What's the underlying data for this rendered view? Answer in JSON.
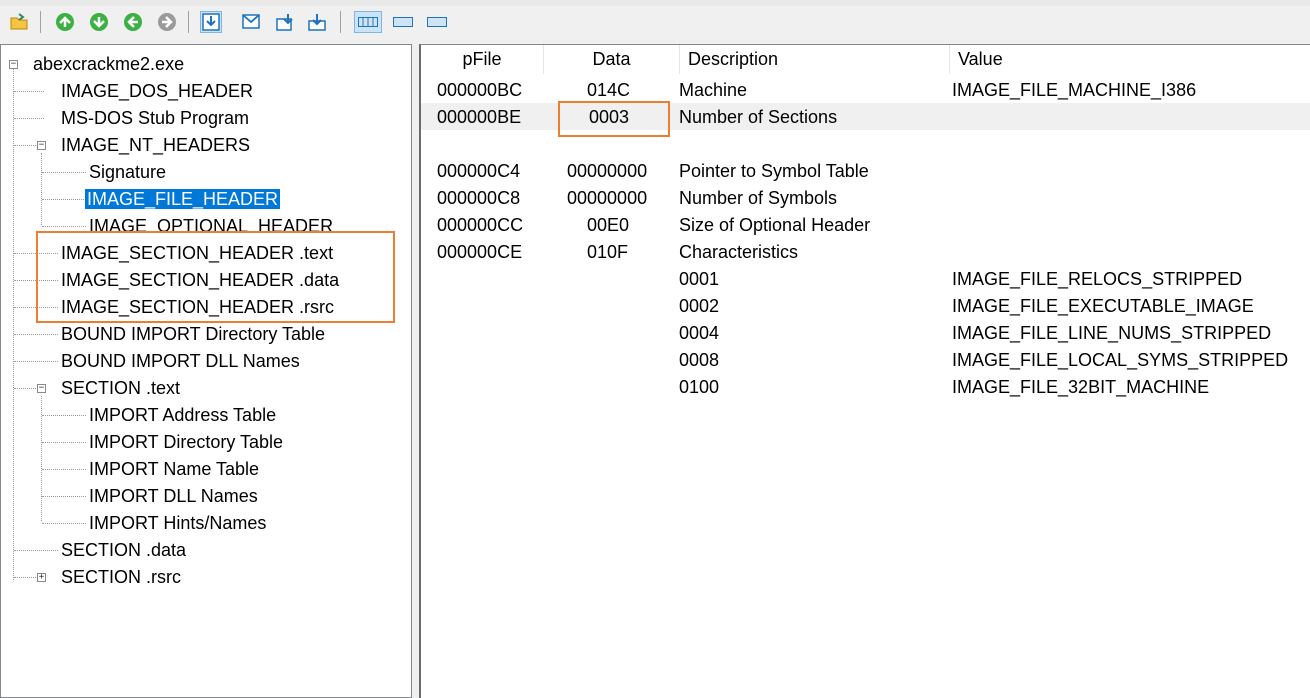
{
  "toolbar": {
    "buttons": [
      "open-icon",
      "up-green-icon",
      "down-green-icon",
      "back-green-icon",
      "forward-gray-icon",
      "view-details-icon",
      "view-mail-icon",
      "view-insert-icon",
      "view-download-icon",
      "view-bytes-icon",
      "view-small-icon",
      "view-wide-icon"
    ]
  },
  "tree": {
    "root": "abexcrackme2.exe",
    "items": [
      "IMAGE_DOS_HEADER",
      "MS-DOS Stub Program",
      "IMAGE_NT_HEADERS",
      "Signature",
      "IMAGE_FILE_HEADER",
      "IMAGE_OPTIONAL_HEADER",
      "IMAGE_SECTION_HEADER .text",
      "IMAGE_SECTION_HEADER .data",
      "IMAGE_SECTION_HEADER .rsrc",
      "BOUND IMPORT Directory Table",
      "BOUND IMPORT DLL Names",
      "SECTION .text",
      "IMPORT Address Table",
      "IMPORT Directory Table",
      "IMPORT Name Table",
      "IMPORT DLL Names",
      "IMPORT Hints/Names",
      "SECTION .data",
      "SECTION .rsrc"
    ],
    "selected": "IMAGE_FILE_HEADER"
  },
  "list": {
    "headers": [
      "pFile",
      "Data",
      "Description",
      "Value"
    ],
    "rows": [
      {
        "pfile": "000000BC",
        "data": "014C",
        "desc": "Machine",
        "value": "IMAGE_FILE_MACHINE_I386"
      },
      {
        "pfile": "000000BE",
        "data": "0003",
        "desc": "Number of Sections",
        "value": ""
      },
      {
        "pfile": "000000C4",
        "data": "00000000",
        "desc": "Pointer to Symbol Table",
        "value": ""
      },
      {
        "pfile": "000000C8",
        "data": "00000000",
        "desc": "Number of Symbols",
        "value": ""
      },
      {
        "pfile": "000000CC",
        "data": "00E0",
        "desc": "Size of Optional Header",
        "value": ""
      },
      {
        "pfile": "000000CE",
        "data": "010F",
        "desc": "Characteristics",
        "value": ""
      },
      {
        "pfile": "",
        "data": "",
        "desc": "0001",
        "value": "IMAGE_FILE_RELOCS_STRIPPED"
      },
      {
        "pfile": "",
        "data": "",
        "desc": "0002",
        "value": "IMAGE_FILE_EXECUTABLE_IMAGE"
      },
      {
        "pfile": "",
        "data": "",
        "desc": "0004",
        "value": "IMAGE_FILE_LINE_NUMS_STRIPPED"
      },
      {
        "pfile": "",
        "data": "",
        "desc": "0008",
        "value": "IMAGE_FILE_LOCAL_SYMS_STRIPPED"
      },
      {
        "pfile": "",
        "data": "",
        "desc": "0100",
        "value": "IMAGE_FILE_32BIT_MACHINE"
      }
    ]
  },
  "colors": {
    "highlight": "#ed7d31",
    "selection": "#0078d7"
  }
}
